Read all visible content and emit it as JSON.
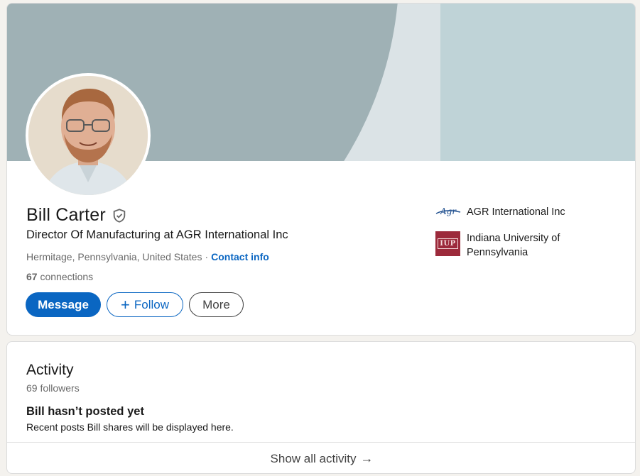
{
  "profile": {
    "name": "Bill Carter",
    "headline": "Director Of Manufacturing at AGR International Inc",
    "location": "Hermitage, Pennsylvania, United States",
    "separator": "·",
    "contact_info_label": "Contact info",
    "connections_count": "67",
    "connections_label": "connections",
    "verified_icon": "shield-check-icon",
    "avatar_icon": "profile-photo"
  },
  "actions": {
    "message_label": "Message",
    "follow_plus": "+",
    "follow_label": "Follow",
    "more_label": "More"
  },
  "organizations": [
    {
      "logo_text": "Agr",
      "name": "AGR International Inc"
    },
    {
      "logo_text": "IUP",
      "name": "Indiana University of Pennsylvania"
    }
  ],
  "activity": {
    "title": "Activity",
    "followers": "69 followers",
    "empty_title": "Bill hasn’t posted yet",
    "empty_subtitle": "Recent posts Bill shares will be displayed here.",
    "show_all_label": "Show all activity",
    "show_all_arrow": "→"
  },
  "colors": {
    "accent": "#0a66c2",
    "banner_dark": "#9fb1b5",
    "banner_light": "#dbe3e6",
    "banner_right": "#bfd3d7",
    "iup_red": "#9c2a3b",
    "page_bg": "#f4f2ee"
  }
}
